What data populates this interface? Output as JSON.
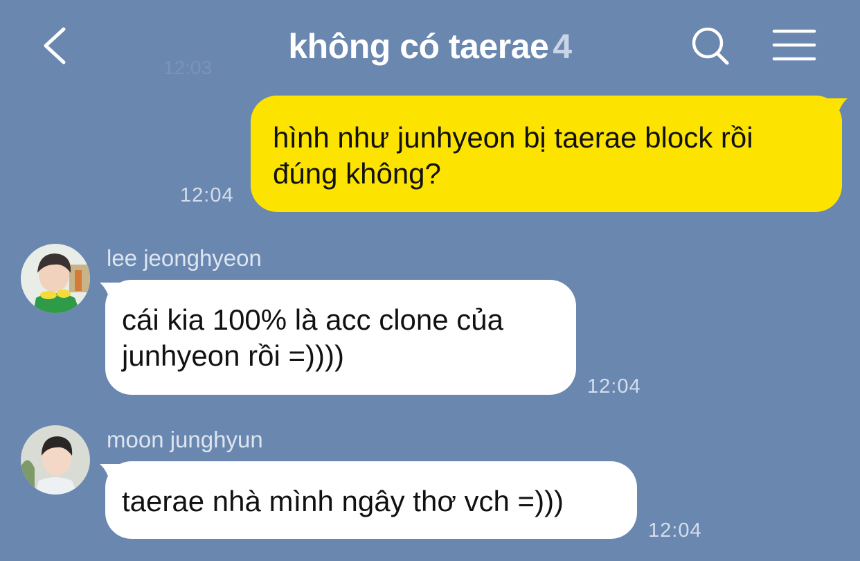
{
  "header": {
    "title": "không có taerae",
    "member_count": "4",
    "back_icon": "chevron-left-icon",
    "search_icon": "search-icon",
    "menu_icon": "hamburger-menu-icon"
  },
  "ghost_timestamp": "12:03",
  "messages": [
    {
      "direction": "outgoing",
      "text": "hình như junhyeon bị taerae block rồi đúng không?",
      "time": "12:04"
    },
    {
      "direction": "incoming",
      "sender": "lee jeonghyeon",
      "text": "cái kia 100% là acc clone của junhyeon rồi =))))",
      "time": "12:04"
    },
    {
      "direction": "incoming",
      "sender": "moon junghyun",
      "text": "taerae nhà mình ngây thơ vch =)))",
      "time": "12:04"
    }
  ],
  "colors": {
    "background": "#6a87b0",
    "outgoing_bubble": "#fde400",
    "incoming_bubble": "#ffffff"
  }
}
